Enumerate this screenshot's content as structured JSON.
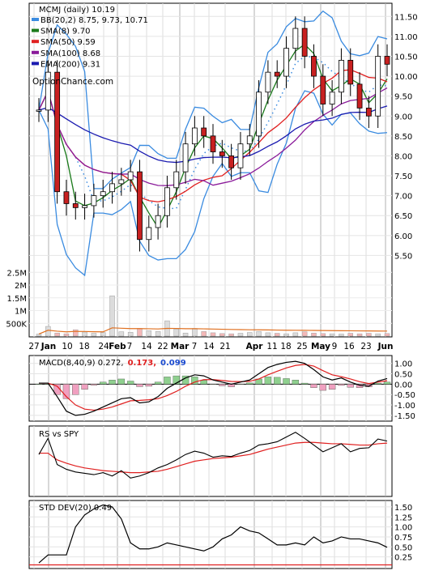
{
  "chart_data": {
    "type": "line",
    "title": "MCMJ (daily) 10.19",
    "brand": "OptionChance.com",
    "x_labels": [
      "27",
      "Jan",
      "10",
      "18",
      "24",
      "Feb",
      "7",
      "14",
      "22",
      "Mar",
      "7",
      "14",
      "21",
      "Apr",
      "11",
      "18",
      "25",
      "May",
      "9",
      "16",
      "23",
      "Jun"
    ],
    "price_panel": {
      "y_ticks": [
        "11.50",
        "11.00",
        "10.50",
        "10.00",
        "9.50",
        "9.00",
        "8.50",
        "8.00",
        "7.50",
        "7.00",
        "6.50",
        "6.00",
        "5.50"
      ],
      "ylim": [
        5.0,
        11.75
      ],
      "legend": [
        {
          "label": "BB(20,2) 8.75, 9.73, 10.71",
          "color": "#3a8be0"
        },
        {
          "label": "SMA(8) 9.70",
          "color": "#1a7a1a"
        },
        {
          "label": "SMA(50) 9.59",
          "color": "#e02020"
        },
        {
          "label": "SMA(100) 8.68",
          "color": "#8a1a9a"
        },
        {
          "label": "EMA(200) 9.31",
          "color": "#1a1ab0"
        }
      ],
      "close": [
        9.15,
        10.1,
        7.1,
        6.8,
        6.7,
        6.75,
        7.0,
        7.1,
        7.3,
        7.4,
        7.6,
        5.9,
        6.2,
        6.5,
        7.2,
        7.6,
        8.3,
        8.7,
        8.5,
        8.1,
        8.0,
        7.7,
        8.3,
        8.5,
        9.6,
        10.1,
        10.0,
        10.7,
        11.2,
        10.5,
        10.0,
        9.3,
        9.6,
        10.4,
        9.8,
        9.2,
        9.0,
        10.5,
        10.3
      ]
    },
    "volume_panel": {
      "y_ticks": [
        "2.5M",
        "2M",
        "1.5M",
        "1M",
        "500K"
      ],
      "ylim": [
        0,
        2700000
      ],
      "values": [
        80000,
        380000,
        120000,
        90000,
        250000,
        160000,
        110000,
        140000,
        1580000,
        170000,
        150000,
        300000,
        210000,
        180000,
        600000,
        280000,
        120000,
        300000,
        180000,
        130000,
        100000,
        90000,
        110000,
        140000,
        180000,
        130000,
        110000,
        90000,
        130000,
        170000,
        120000,
        100000,
        90000,
        80000,
        110000,
        90000,
        110000,
        90000,
        100000
      ]
    },
    "macd_panel": {
      "label": "MACD(8,40,9) 0.272,",
      "signal_value": "0.173,",
      "hist_value": "0.099",
      "y_ticks": [
        "1.00",
        "0.50",
        "0.00",
        "-0.50",
        "-1.00",
        "-1.50"
      ],
      "ylim": [
        -1.7,
        1.3
      ],
      "macd": [
        0.05,
        0.05,
        -0.6,
        -1.3,
        -1.5,
        -1.45,
        -1.3,
        -1.1,
        -0.9,
        -0.7,
        -0.65,
        -0.9,
        -0.85,
        -0.6,
        -0.2,
        0.05,
        0.3,
        0.45,
        0.4,
        0.2,
        0.1,
        0.0,
        0.1,
        0.2,
        0.5,
        0.8,
        0.95,
        1.05,
        1.1,
        1.0,
        0.7,
        0.35,
        0.2,
        0.3,
        0.1,
        -0.05,
        -0.1,
        0.15,
        0.27
      ],
      "signal": [
        0.05,
        0.05,
        -0.1,
        -0.6,
        -1.0,
        -1.2,
        -1.25,
        -1.2,
        -1.1,
        -0.95,
        -0.8,
        -0.78,
        -0.75,
        -0.7,
        -0.55,
        -0.35,
        -0.1,
        0.1,
        0.22,
        0.22,
        0.18,
        0.13,
        0.12,
        0.14,
        0.25,
        0.45,
        0.62,
        0.78,
        0.9,
        0.95,
        0.87,
        0.65,
        0.45,
        0.36,
        0.25,
        0.12,
        0.03,
        0.1,
        0.17
      ]
    },
    "rs_panel": {
      "label": "RS vs SPY",
      "rs": [
        0.6,
        0.84,
        0.45,
        0.38,
        0.34,
        0.32,
        0.3,
        0.33,
        0.28,
        0.36,
        0.25,
        0.28,
        0.33,
        0.4,
        0.45,
        0.52,
        0.6,
        0.65,
        0.62,
        0.56,
        0.58,
        0.57,
        0.62,
        0.66,
        0.74,
        0.76,
        0.79,
        0.86,
        0.93,
        0.84,
        0.74,
        0.64,
        0.7,
        0.76,
        0.64,
        0.69,
        0.7,
        0.83,
        0.8
      ],
      "avg": [
        0.62,
        0.62,
        0.52,
        0.47,
        0.43,
        0.4,
        0.38,
        0.36,
        0.35,
        0.34,
        0.33,
        0.33,
        0.34,
        0.35,
        0.38,
        0.42,
        0.46,
        0.5,
        0.52,
        0.54,
        0.55,
        0.56,
        0.58,
        0.6,
        0.64,
        0.68,
        0.71,
        0.74,
        0.77,
        0.78,
        0.78,
        0.77,
        0.76,
        0.76,
        0.75,
        0.74,
        0.74,
        0.76,
        0.77
      ]
    },
    "std_panel": {
      "label": "STD DEV(20) 0.49",
      "y_ticks": [
        "1.50",
        "1.25",
        "1.00",
        "0.75",
        "0.50",
        "0.25"
      ],
      "ylim": [
        0.0,
        1.62
      ],
      "values": [
        0.1,
        0.3,
        0.3,
        0.3,
        1.0,
        1.3,
        1.45,
        1.55,
        1.5,
        1.2,
        0.6,
        0.45,
        0.45,
        0.5,
        0.6,
        0.55,
        0.5,
        0.45,
        0.4,
        0.5,
        0.7,
        0.8,
        1.0,
        0.9,
        0.85,
        0.7,
        0.55,
        0.55,
        0.6,
        0.55,
        0.75,
        0.6,
        0.65,
        0.75,
        0.7,
        0.7,
        0.65,
        0.6,
        0.49
      ]
    }
  }
}
